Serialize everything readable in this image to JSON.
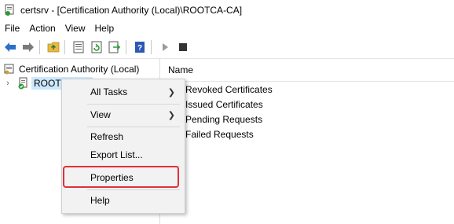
{
  "window": {
    "title": "certsrv - [Certification Authority (Local)\\ROOTCA-CA]"
  },
  "menubar": {
    "items": [
      {
        "label": "File"
      },
      {
        "label": "Action"
      },
      {
        "label": "View"
      },
      {
        "label": "Help"
      }
    ]
  },
  "toolbar": {
    "buttons": [
      "back-arrow-icon",
      "forward-arrow-icon",
      "up-folder-icon",
      "properties-icon",
      "refresh-icon",
      "export-icon",
      "help-icon",
      "start-service-icon",
      "stop-service-icon"
    ]
  },
  "tree": {
    "root_label": "Certification Authority (Local)",
    "child_label": "ROOTCA-CA"
  },
  "list": {
    "column_header": "Name",
    "items": [
      {
        "label": "Revoked Certificates"
      },
      {
        "label": "Issued Certificates"
      },
      {
        "label": "Pending Requests"
      },
      {
        "label": "Failed Requests"
      }
    ]
  },
  "context_menu": {
    "items": [
      {
        "label": "All Tasks"
      },
      {
        "label": "View"
      },
      {
        "label": "Refresh"
      },
      {
        "label": "Export List..."
      },
      {
        "label": "Properties"
      },
      {
        "label": "Help"
      }
    ],
    "highlight_color": "#e0303a"
  },
  "colors": {
    "selection": "#cce8ff",
    "menu_bg": "#f2f2f2",
    "folder": "#e8b93e"
  }
}
